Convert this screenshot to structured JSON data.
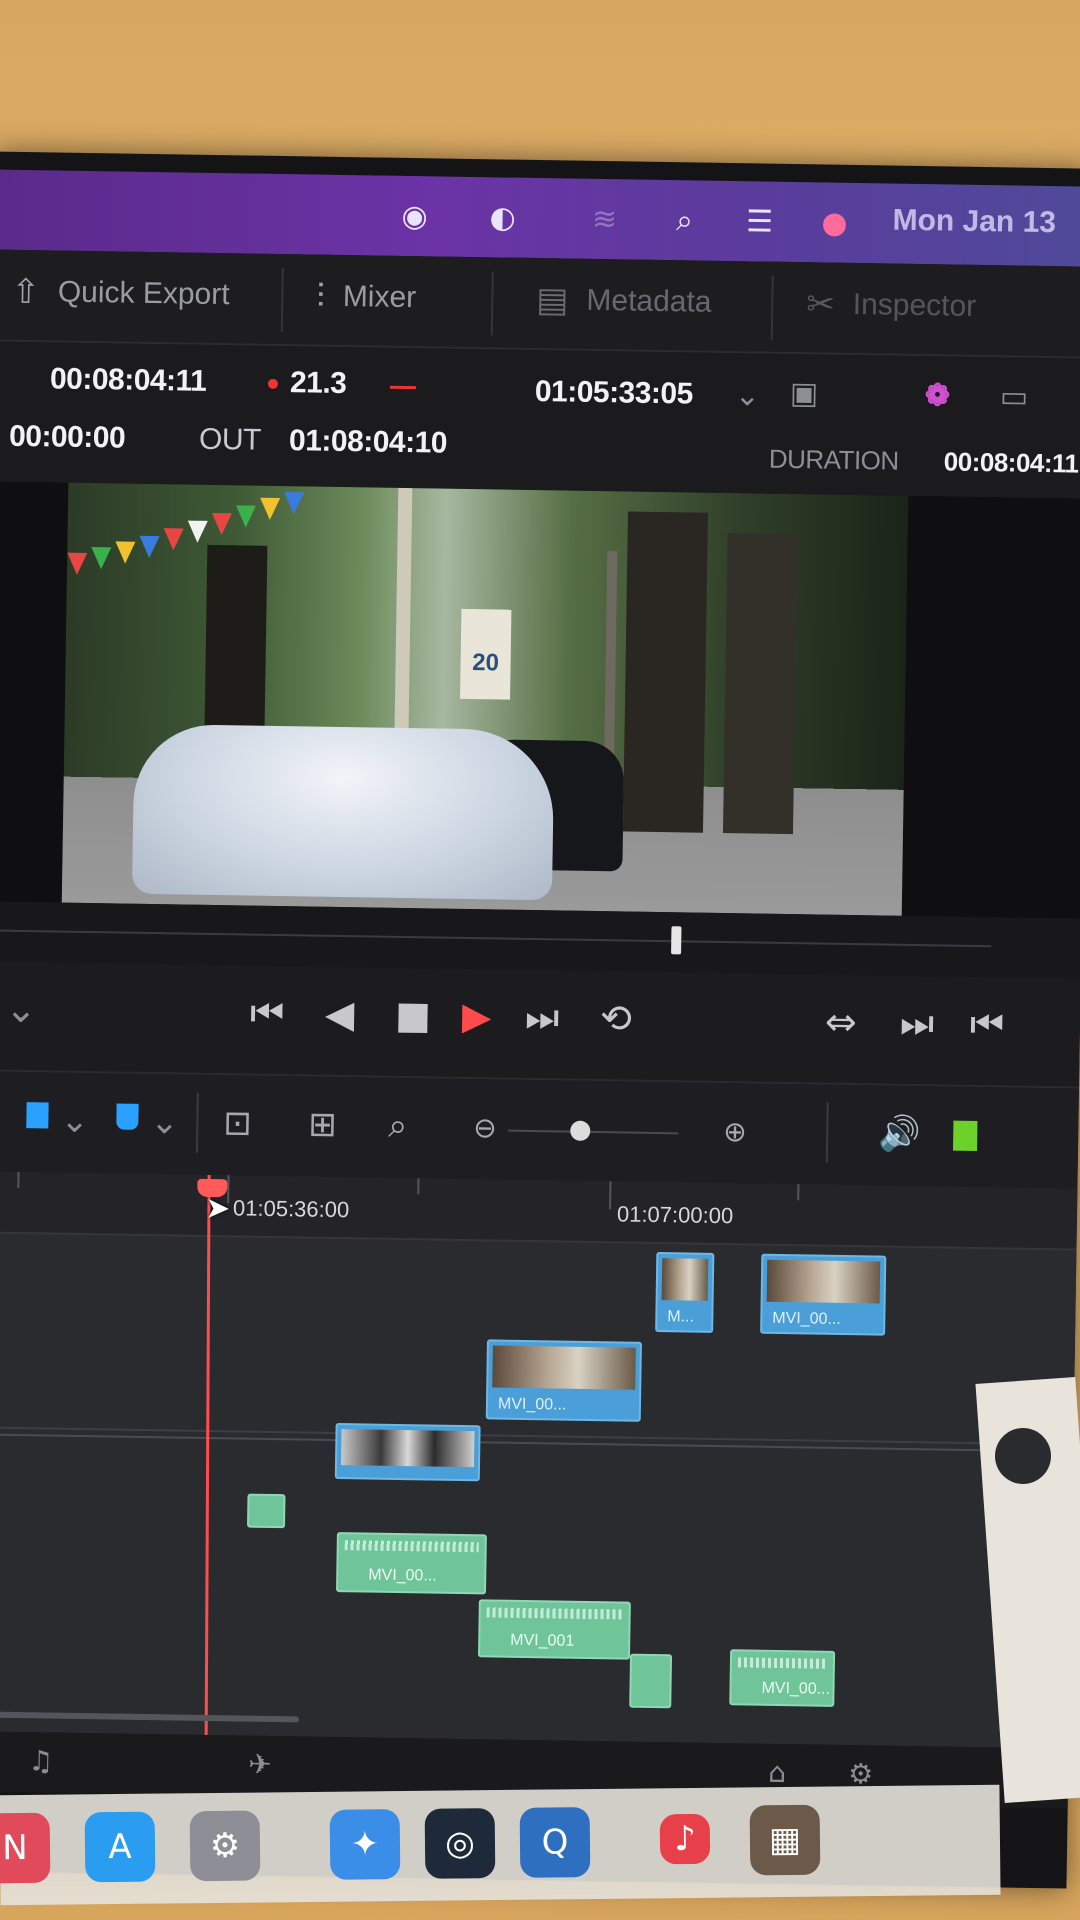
{
  "menubar": {
    "clock": "Mon Jan 13",
    "icons": [
      "record-icon",
      "focus-icon",
      "wifi-icon",
      "search-icon",
      "control-center-icon",
      "siri-icon"
    ]
  },
  "toolbar": {
    "quick_export": "Quick Export",
    "mixer": "Mixer",
    "metadata": "Metadata",
    "inspector": "Inspector"
  },
  "timecodes": {
    "source_tc": "00:08:04:11",
    "fps": "21.3",
    "record_tc": "01:05:33:05",
    "in_tc": "00:00:00",
    "out_label": "OUT",
    "out_tc": "01:08:04:10",
    "duration_label": "DURATION",
    "duration_tc": "00:08:04:11"
  },
  "viewer": {
    "speed_sign": "20",
    "scrub_position": 0.68
  },
  "transport": {
    "buttons": [
      "skip-back-icon",
      "play-reverse-icon",
      "stop-icon",
      "play-icon",
      "skip-forward-icon",
      "loop-icon"
    ]
  },
  "timeline": {
    "ruler_marks": [
      "01:05:36:00",
      "01:07:00:00"
    ],
    "video_clips": [
      {
        "label": "M..."
      },
      {
        "label": "MVI_00..."
      },
      {
        "label": "MVI_00..."
      },
      {
        "label": ""
      }
    ],
    "audio_clips": [
      {
        "label": ""
      },
      {
        "label": "MVI_00..."
      },
      {
        "label": "MVI_001"
      },
      {
        "label": ""
      },
      {
        "label": "MVI_00..."
      }
    ]
  },
  "colors": {
    "accent_play": "#ff4b4b",
    "video_clip": "#4a9fd8",
    "audio_clip": "#6fc49a",
    "playhead": "#ff4d4d",
    "menubar": "#6b33a6"
  }
}
